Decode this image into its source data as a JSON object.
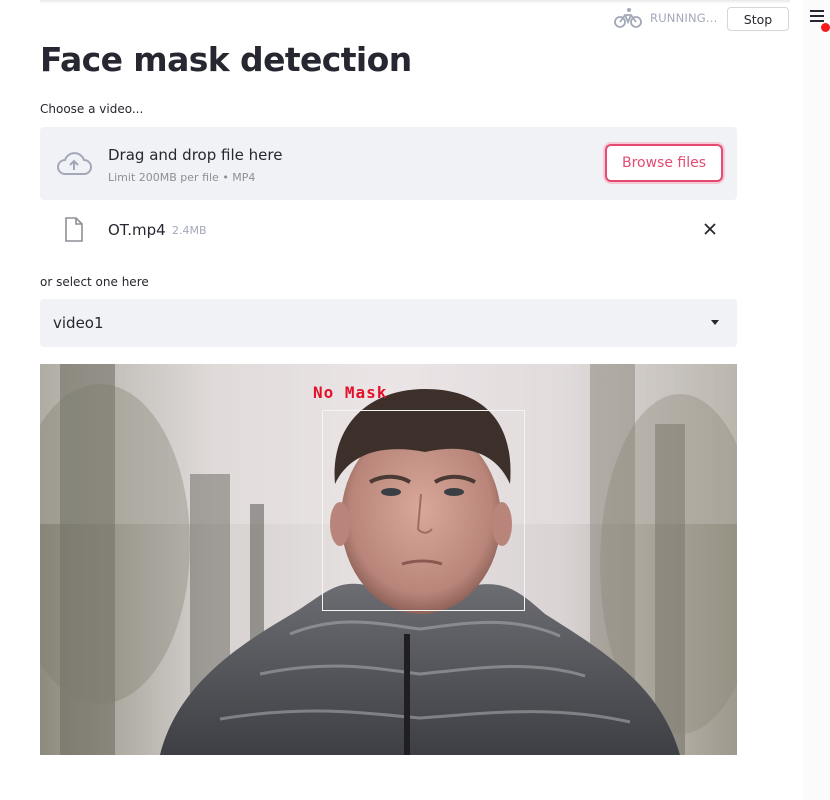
{
  "header": {
    "status_text": "RUNNING...",
    "stop_label": "Stop",
    "status_icon": "bike-icon",
    "menu_icon": "hamburger-icon"
  },
  "title": "Face mask detection",
  "uploader": {
    "label": "Choose a video...",
    "drop_text": "Drag and drop file here",
    "limit_text": "Limit 200MB per file • MP4",
    "browse_label": "Browse files",
    "accent_color": "#e34b73"
  },
  "uploaded_file": {
    "name": "OT.mp4",
    "size": "2.4MB"
  },
  "selector": {
    "label": "or select one here",
    "selected": "video1"
  },
  "video": {
    "detection_label": "No Mask",
    "label_color": "#e4102a"
  }
}
